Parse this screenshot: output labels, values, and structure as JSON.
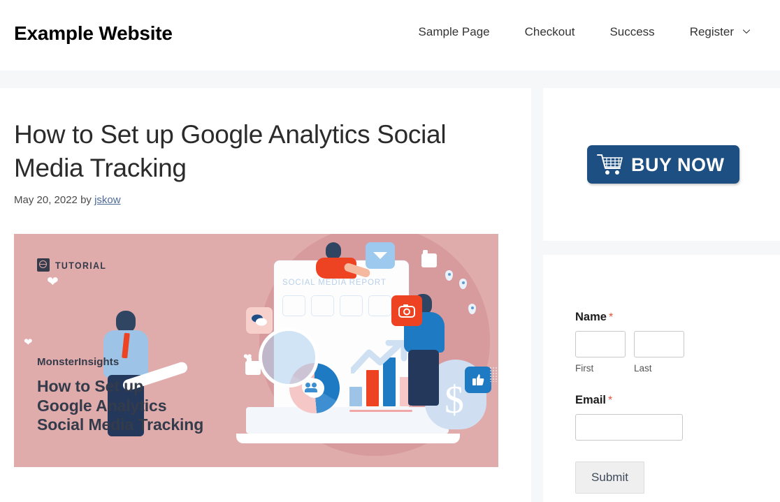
{
  "header": {
    "site_title": "Example Website",
    "nav": [
      {
        "label": "Sample Page",
        "has_dropdown": false
      },
      {
        "label": "Checkout",
        "has_dropdown": false
      },
      {
        "label": "Success",
        "has_dropdown": false
      },
      {
        "label": "Register",
        "has_dropdown": true
      }
    ]
  },
  "article": {
    "title": "How to Set up Google Analytics Social Media Tracking",
    "meta_date": "May 20, 2022",
    "meta_by": "by",
    "meta_author": "jskow",
    "featured_image": {
      "badge_label": "TUTORIAL",
      "badge_icon": "book-globe-icon",
      "brand": "MonsterInsights",
      "headline_line1": "How to Set up",
      "headline_line2": "Google Analytics",
      "headline_line3": "Social Media Tracking",
      "illustration_caption": "SOCIAL MEDIA REPORT",
      "percent_label": "%",
      "dollar_label": "$",
      "background_color": "#dfabab",
      "text_color": "#343b4a"
    }
  },
  "sidebar": {
    "buy_widget": {
      "button_label": "BUY NOW",
      "icon": "shopping-cart-icon",
      "color": "#1d4f82"
    },
    "form_widget": {
      "name_label": "Name",
      "name_required_mark": "*",
      "first_value": "",
      "first_sublabel": "First",
      "last_value": "",
      "last_sublabel": "Last",
      "email_label": "Email",
      "email_required_mark": "*",
      "email_value": "",
      "submit_label": "Submit",
      "required_color": "#e8503a"
    }
  }
}
